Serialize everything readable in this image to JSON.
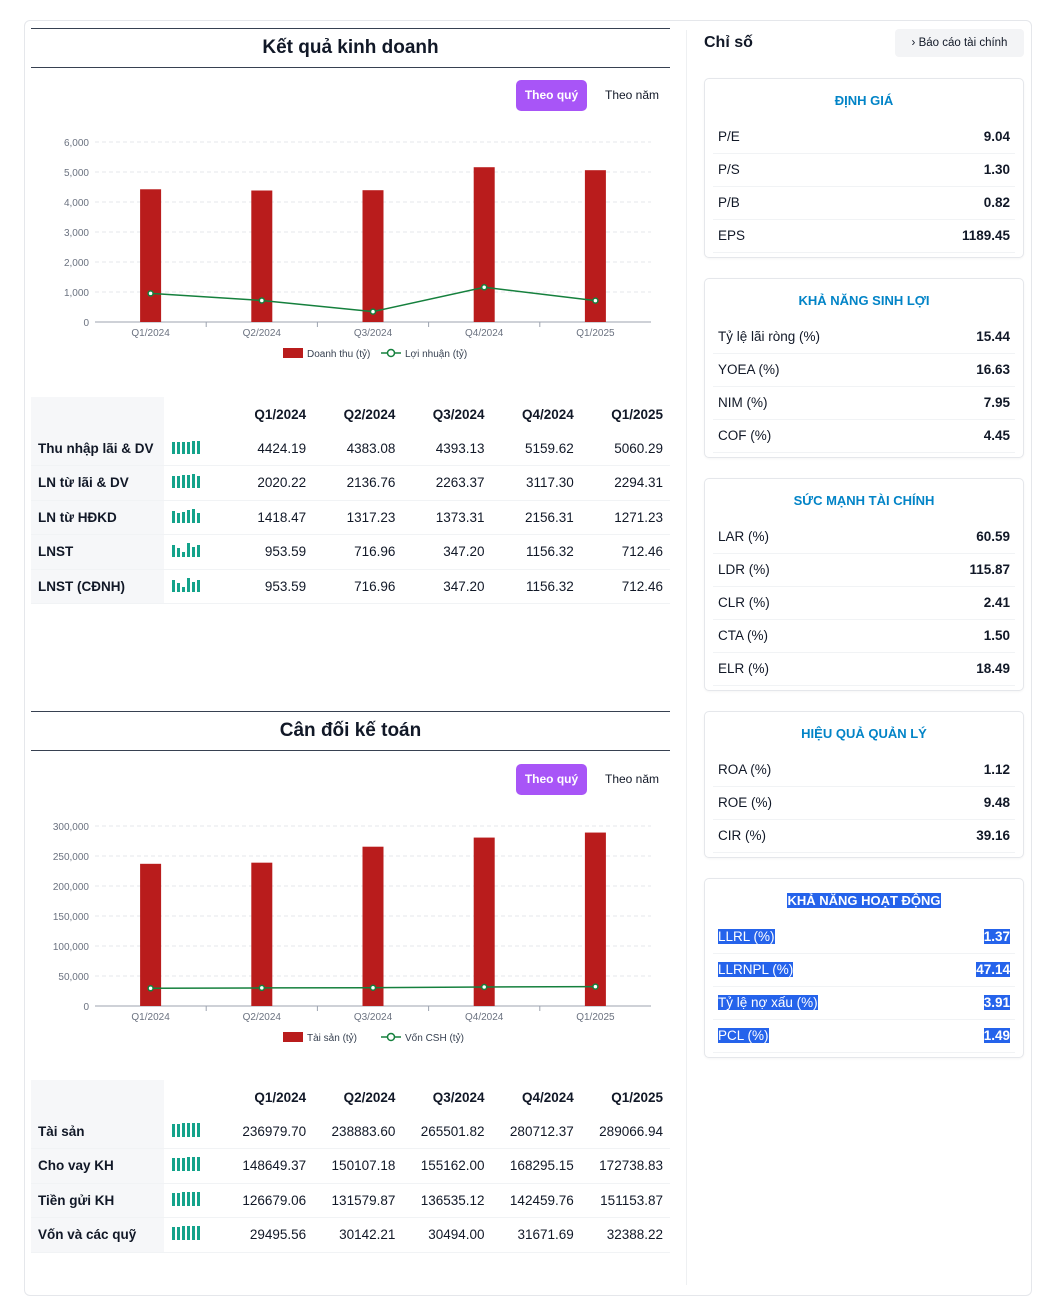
{
  "business": {
    "title": "Kết quả kinh doanh",
    "toggle_quarter": "Theo quý",
    "toggle_year": "Theo năm",
    "table": {
      "columns": [
        "Q1/2024",
        "Q2/2024",
        "Q3/2024",
        "Q4/2024",
        "Q1/2025"
      ],
      "rows": [
        {
          "label": "Thu nhập lãi & DV",
          "values": [
            "4424.19",
            "4383.08",
            "4393.13",
            "5159.62",
            "5060.29"
          ]
        },
        {
          "label": "LN từ lãi & DV",
          "values": [
            "2020.22",
            "2136.76",
            "2263.37",
            "3117.30",
            "2294.31"
          ]
        },
        {
          "label": "LN từ HĐKD",
          "values": [
            "1418.47",
            "1317.23",
            "1373.31",
            "2156.31",
            "1271.23"
          ]
        },
        {
          "label": "LNST",
          "values": [
            "953.59",
            "716.96",
            "347.20",
            "1156.32",
            "712.46"
          ]
        },
        {
          "label": "LNST (CĐNH)",
          "values": [
            "953.59",
            "716.96",
            "347.20",
            "1156.32",
            "712.46"
          ]
        }
      ]
    }
  },
  "balance": {
    "title": "Cân đối kế toán",
    "toggle_quarter": "Theo quý",
    "toggle_year": "Theo năm",
    "table": {
      "columns": [
        "Q1/2024",
        "Q2/2024",
        "Q3/2024",
        "Q4/2024",
        "Q1/2025"
      ],
      "rows": [
        {
          "label": "Tài sản",
          "values": [
            "236979.70",
            "238883.60",
            "265501.82",
            "280712.37",
            "289066.94"
          ]
        },
        {
          "label": "Cho vay KH",
          "values": [
            "148649.37",
            "150107.18",
            "155162.00",
            "168295.15",
            "172738.83"
          ]
        },
        {
          "label": "Tiền gửi KH",
          "values": [
            "126679.06",
            "131579.87",
            "136535.12",
            "142459.76",
            "151153.87"
          ]
        },
        {
          "label": "Vốn và các quỹ",
          "values": [
            "29495.56",
            "30142.21",
            "30494.00",
            "31671.69",
            "32388.22"
          ]
        }
      ]
    }
  },
  "chart_data": [
    {
      "type": "bar",
      "categories": [
        "Q1/2024",
        "Q2/2024",
        "Q3/2024",
        "Q4/2024",
        "Q1/2025"
      ],
      "series": [
        {
          "name": "Doanh thu (tỷ)",
          "type": "bar",
          "values": [
            4424.19,
            4383.08,
            4393.13,
            5159.62,
            5060.29
          ],
          "color": "#b91c1c"
        },
        {
          "name": "Lợi nhuận (tỷ)",
          "type": "line",
          "values": [
            953.59,
            716.96,
            347.2,
            1156.32,
            712.46
          ],
          "color": "#15803d"
        }
      ],
      "yticks": [
        "0",
        "1,000",
        "2,000",
        "3,000",
        "4,000",
        "5,000",
        "6,000"
      ],
      "ylim": [
        0,
        6000
      ],
      "grid": true,
      "legend": "bottom"
    },
    {
      "type": "bar",
      "categories": [
        "Q1/2024",
        "Q2/2024",
        "Q3/2024",
        "Q4/2024",
        "Q1/2025"
      ],
      "series": [
        {
          "name": "Tài sản (tỷ)",
          "type": "bar",
          "values": [
            236979.7,
            238883.6,
            265501.82,
            280712.37,
            289066.94
          ],
          "color": "#b91c1c"
        },
        {
          "name": "Vốn CSH (tỷ)",
          "type": "line",
          "values": [
            29495.56,
            30142.21,
            30494.0,
            31671.69,
            32388.22
          ],
          "color": "#15803d"
        }
      ],
      "yticks": [
        "0",
        "50,000",
        "100,000",
        "150,000",
        "200,000",
        "250,000",
        "300,000"
      ],
      "ylim": [
        0,
        300000
      ],
      "grid": true,
      "legend": "bottom"
    }
  ],
  "right": {
    "title": "Chỉ số",
    "report_button": "Báo cáo tài chính",
    "cards": [
      {
        "title": "ĐỊNH GIÁ",
        "rows": [
          [
            "P/E",
            "9.04"
          ],
          [
            "P/S",
            "1.30"
          ],
          [
            "P/B",
            "0.82"
          ],
          [
            "EPS",
            "1189.45"
          ]
        ]
      },
      {
        "title": "KHẢ NĂNG SINH LỢI",
        "rows": [
          [
            "Tỷ lệ lãi ròng (%)",
            "15.44"
          ],
          [
            "YOEA (%)",
            "16.63"
          ],
          [
            "NIM (%)",
            "7.95"
          ],
          [
            "COF (%)",
            "4.45"
          ]
        ]
      },
      {
        "title": "SỨC MẠNH TÀI CHÍNH",
        "rows": [
          [
            "LAR (%)",
            "60.59"
          ],
          [
            "LDR (%)",
            "115.87"
          ],
          [
            "CLR (%)",
            "2.41"
          ],
          [
            "CTA (%)",
            "1.50"
          ],
          [
            "ELR (%)",
            "18.49"
          ]
        ]
      },
      {
        "title": "HIỆU QUẢ QUẢN LÝ",
        "rows": [
          [
            "ROA (%)",
            "1.12"
          ],
          [
            "ROE (%)",
            "9.48"
          ],
          [
            "CIR (%)",
            "39.16"
          ]
        ]
      },
      {
        "title": "KHẢ NĂNG HOẠT ĐỘNG",
        "rows": [
          [
            "LLRL (%)",
            "1.37"
          ],
          [
            "LLRNPL (%)",
            "47.14"
          ],
          [
            "Tỷ lệ nợ xấu (%)",
            "3.91"
          ],
          [
            "PCL (%)",
            "1.49"
          ]
        ]
      }
    ]
  }
}
